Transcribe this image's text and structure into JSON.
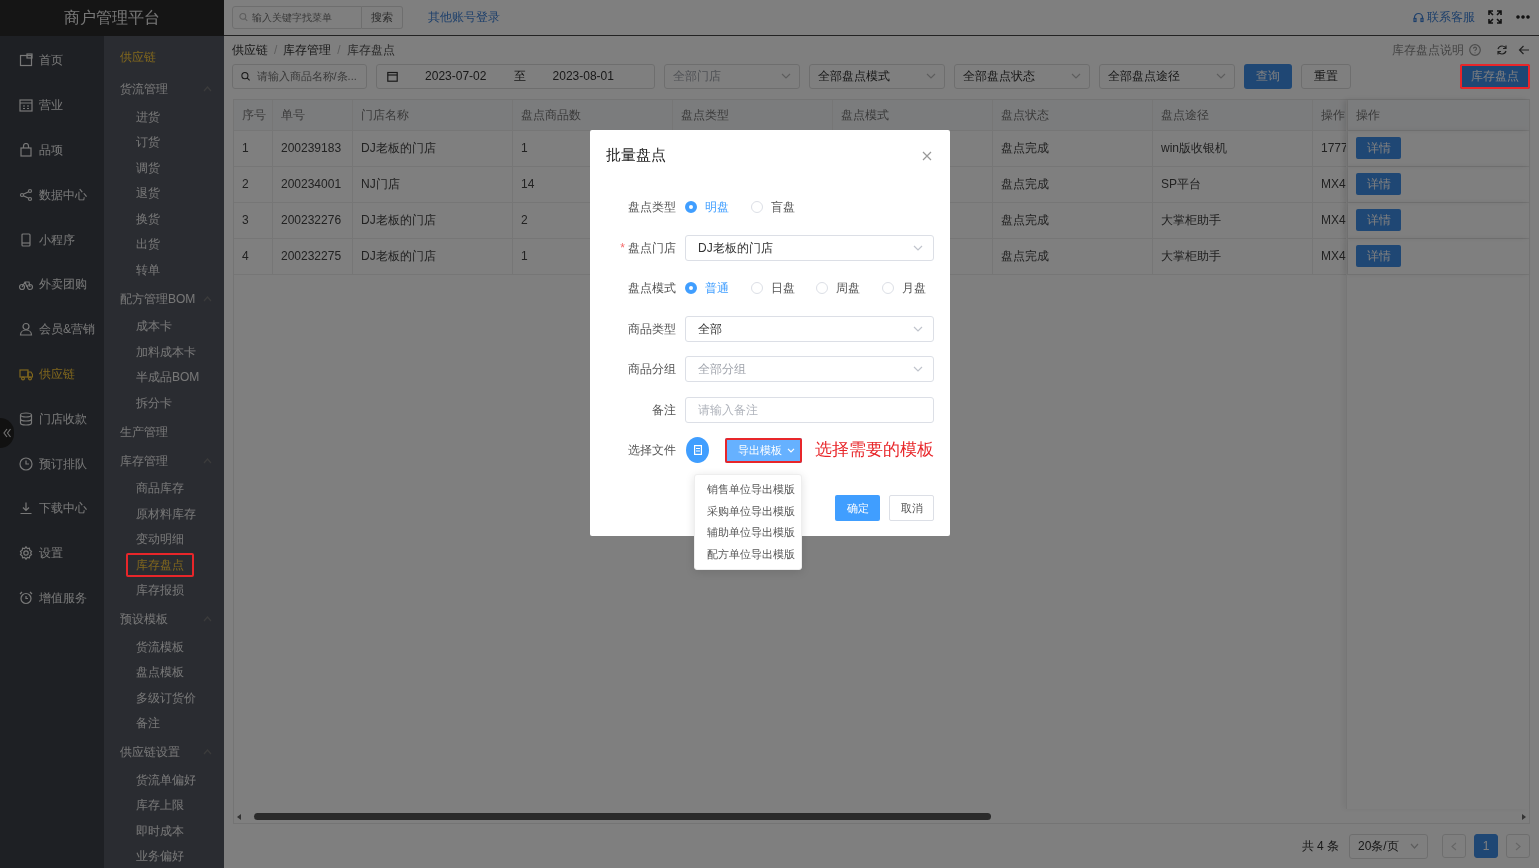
{
  "app_title": "商户管理平台",
  "topbar": {
    "search": {
      "placeholder": "输入关键字找菜单"
    },
    "search_button": "搜索",
    "other_login": "其他账号登录",
    "support": "联系客服"
  },
  "nav": [
    {
      "label": "首页",
      "kind": "home",
      "selected": false
    },
    {
      "label": "营业",
      "kind": "calendar",
      "selected": false
    },
    {
      "label": "品项",
      "kind": "bag",
      "selected": false
    },
    {
      "label": "数据中心",
      "kind": "share",
      "selected": false
    },
    {
      "label": "小程序",
      "kind": "phone",
      "selected": false
    },
    {
      "label": "外卖团购",
      "kind": "bike",
      "selected": false
    },
    {
      "label": "会员&营销",
      "kind": "person",
      "selected": false
    },
    {
      "label": "供应链",
      "kind": "truck",
      "selected": true
    },
    {
      "label": "门店收款",
      "kind": "database",
      "selected": false
    },
    {
      "label": "预订排队",
      "kind": "clock",
      "selected": false
    },
    {
      "label": "下载中心",
      "kind": "download",
      "selected": false
    },
    {
      "label": "设置",
      "kind": "gear",
      "selected": false
    },
    {
      "label": "增值服务",
      "kind": "alarm",
      "selected": false
    }
  ],
  "subnav": {
    "title": "供应链",
    "groups": [
      {
        "label": "货流管理",
        "expanded": true,
        "children": [
          {
            "label": "进货",
            "selected": false
          },
          {
            "label": "订货",
            "selected": false
          },
          {
            "label": "调货",
            "selected": false
          },
          {
            "label": "退货",
            "selected": false
          },
          {
            "label": "换货",
            "selected": false
          },
          {
            "label": "出货",
            "selected": false
          },
          {
            "label": "转单",
            "selected": false
          }
        ]
      },
      {
        "label": "配方管理BOM",
        "expanded": true,
        "children": [
          {
            "label": "成本卡",
            "selected": false
          },
          {
            "label": "加料成本卡",
            "selected": false
          },
          {
            "label": "半成品BOM",
            "selected": false
          },
          {
            "label": "拆分卡",
            "selected": false
          }
        ]
      },
      {
        "label": "生产管理"
      },
      {
        "label": "库存管理",
        "expanded": true,
        "children": [
          {
            "label": "商品库存",
            "selected": false
          },
          {
            "label": "原材料库存",
            "selected": false
          },
          {
            "label": "变动明细",
            "selected": false
          },
          {
            "label": "库存盘点",
            "selected": true,
            "highlighted": true
          },
          {
            "label": "库存报损",
            "selected": false
          }
        ]
      },
      {
        "label": "预设模板",
        "expanded": true,
        "children": [
          {
            "label": "货流模板",
            "selected": false
          },
          {
            "label": "盘点模板",
            "selected": false
          },
          {
            "label": "多级订货价",
            "selected": false
          },
          {
            "label": "备注",
            "selected": false
          }
        ]
      },
      {
        "label": "供应链设置",
        "expanded": true,
        "children": [
          {
            "label": "货流单偏好",
            "selected": false
          },
          {
            "label": "库存上限",
            "selected": false
          },
          {
            "label": "即时成本",
            "selected": false
          },
          {
            "label": "业务偏好",
            "selected": false
          }
        ]
      }
    ]
  },
  "breadcrumb": [
    "供应链",
    "库存管理",
    "库存盘点"
  ],
  "breadcrumb_separator": "/",
  "help_link": "库存盘点说明",
  "filters": {
    "search": {
      "placeholder": "请输入商品名称/条..."
    },
    "date_from": "2023-07-02",
    "date_sep": "至",
    "date_to": "2023-08-01",
    "selects": [
      {
        "placeholder": "全部门店"
      },
      {
        "value": "全部盘点模式"
      },
      {
        "value": "全部盘点状态"
      },
      {
        "value": "全部盘点途径"
      }
    ],
    "query_button": "查询",
    "reset_button": "重置"
  },
  "stocktake_button": {
    "label": "库存盘点",
    "highlighted": true
  },
  "table": {
    "columns": [
      "序号",
      "单号",
      "门店名称",
      "盘点商品数",
      "盘点类型",
      "盘点模式",
      "盘点状态",
      "盘点途径",
      "操作",
      "操作"
    ],
    "rows": [
      {
        "no": "1",
        "order_no": "200239183",
        "store": "DJ老板的门店",
        "item_count": "1",
        "status": "盘点完成",
        "channel": "win版收银机",
        "operator": "1777",
        "action": "详情"
      },
      {
        "no": "2",
        "order_no": "200234001",
        "store": "NJ门店",
        "item_count": "14",
        "status": "盘点完成",
        "channel": "SP平台",
        "operator": "MX4",
        "action": "详情"
      },
      {
        "no": "3",
        "order_no": "200232276",
        "store": "DJ老板的门店",
        "item_count": "2",
        "status": "盘点完成",
        "channel": "大掌柜助手",
        "operator": "MX4",
        "action": "详情"
      },
      {
        "no": "4",
        "order_no": "200232275",
        "store": "DJ老板的门店",
        "item_count": "1",
        "status": "盘点完成",
        "channel": "大掌柜助手",
        "operator": "MX4",
        "action": "详情"
      }
    ]
  },
  "pagination": {
    "total": "共 4 条",
    "page_size": "20条/页",
    "pages": [
      {
        "label": "1",
        "selected": true
      }
    ]
  },
  "modal": {
    "title": "批量盘点",
    "fields": [
      {
        "kind": "radio",
        "label": "盘点类型",
        "options": [
          {
            "label": "明盘",
            "selected": true
          },
          {
            "label": "盲盘",
            "selected": false
          }
        ]
      },
      {
        "kind": "select",
        "label": "盘点门店",
        "required_mark": "*",
        "value": "DJ老板的门店"
      },
      {
        "kind": "radio",
        "label": "盘点模式",
        "options": [
          {
            "label": "普通",
            "selected": true
          },
          {
            "label": "日盘",
            "selected": false
          },
          {
            "label": "周盘",
            "selected": false
          },
          {
            "label": "月盘",
            "selected": false
          }
        ]
      },
      {
        "kind": "select",
        "label": "商品类型",
        "value": "全部"
      },
      {
        "kind": "select",
        "label": "商品分组",
        "placeholder": "全部分组"
      },
      {
        "kind": "input",
        "label": "备注",
        "placeholder": "请输入备注"
      },
      {
        "kind": "file",
        "label": "选择文件",
        "export_button": {
          "label": "导出模板",
          "highlighted": true
        },
        "menu": [
          "销售单位导出模版",
          "采购单位导出模版",
          "辅助单位导出模版",
          "配方单位导出模版"
        ]
      }
    ],
    "confirm_button": "确定",
    "cancel_button": "取消"
  },
  "annotation": "选择需要的模板"
}
